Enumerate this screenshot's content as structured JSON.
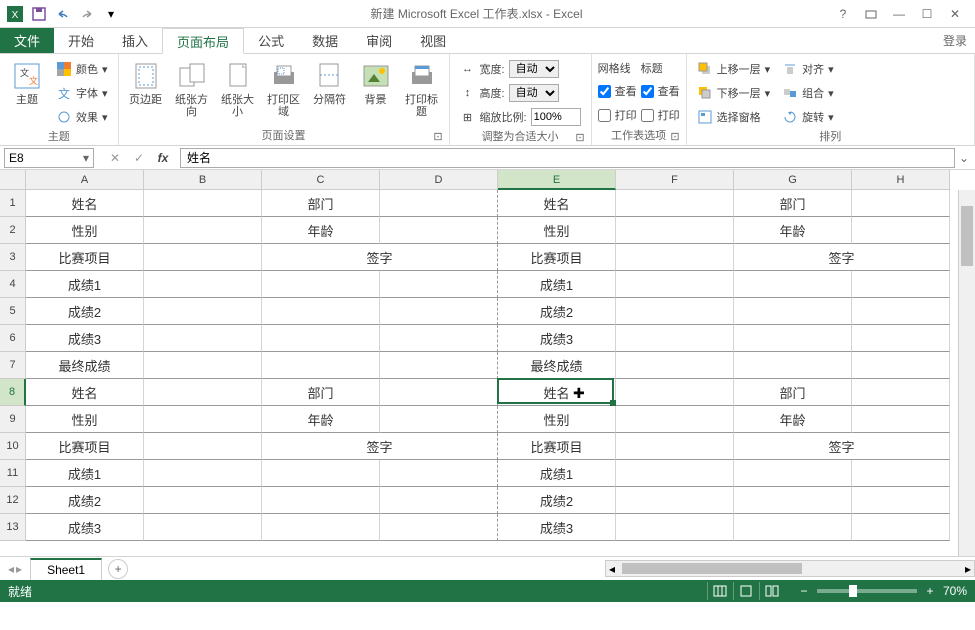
{
  "title": "新建 Microsoft Excel 工作表.xlsx - Excel",
  "menubar": {
    "file": "文件",
    "tabs": [
      "开始",
      "插入",
      "页面布局",
      "公式",
      "数据",
      "审阅",
      "视图"
    ],
    "activeIndex": 2,
    "login": "登录"
  },
  "ribbon": {
    "groups": {
      "theme": {
        "label": "主题",
        "themeBtn": "主题",
        "colors": "颜色",
        "fonts": "字体",
        "effects": "效果"
      },
      "pageSetup": {
        "label": "页面设置",
        "margins": "页边距",
        "orientation": "纸张方向",
        "size": "纸张大小",
        "printArea": "打印区域",
        "breaks": "分隔符",
        "background": "背景",
        "printTitles": "打印标题"
      },
      "scaleToFit": {
        "label": "调整为合适大小",
        "widthLabel": "宽度:",
        "widthValue": "自动",
        "heightLabel": "高度:",
        "heightValue": "自动",
        "scaleLabel": "缩放比例:",
        "scaleValue": "100%"
      },
      "sheetOptions": {
        "label": "工作表选项",
        "gridlines": "网格线",
        "headings": "标题",
        "view": "查看",
        "print": "打印"
      },
      "arrange": {
        "label": "排列",
        "bringForward": "上移一层",
        "sendBackward": "下移一层",
        "selectionPane": "选择窗格",
        "align": "对齐",
        "group": "组合",
        "rotate": "旋转"
      }
    }
  },
  "namebox": "E8",
  "formula": "姓名",
  "columns": [
    {
      "name": "A",
      "width": 118
    },
    {
      "name": "B",
      "width": 118
    },
    {
      "name": "C",
      "width": 118
    },
    {
      "name": "D",
      "width": 118
    },
    {
      "name": "E",
      "width": 118
    },
    {
      "name": "F",
      "width": 118
    },
    {
      "name": "G",
      "width": 118
    },
    {
      "name": "H",
      "width": 98
    }
  ],
  "activeCol": 4,
  "activeRow": 7,
  "rows": [
    {
      "r": 1,
      "h": 27,
      "cells": {
        "A": "姓名",
        "C": "部门",
        "E": "姓名",
        "G": "部门"
      }
    },
    {
      "r": 2,
      "h": 27,
      "cells": {
        "A": "性别",
        "C": "年龄",
        "E": "性别",
        "G": "年龄"
      }
    },
    {
      "r": 3,
      "h": 27,
      "cells": {
        "A": "比赛项目",
        "E": "比赛项目"
      },
      "merge": [
        {
          "text": "签字",
          "start": 2,
          "end": 3
        },
        {
          "text": "签字",
          "start": 6,
          "end": 7
        }
      ]
    },
    {
      "r": 4,
      "h": 27,
      "cells": {
        "A": "成绩1",
        "E": "成绩1"
      }
    },
    {
      "r": 5,
      "h": 27,
      "cells": {
        "A": "成绩2",
        "E": "成绩2"
      }
    },
    {
      "r": 6,
      "h": 27,
      "cells": {
        "A": "成绩3",
        "E": "成绩3"
      }
    },
    {
      "r": 7,
      "h": 27,
      "cells": {
        "A": "最终成绩",
        "E": "最终成绩"
      }
    },
    {
      "r": 8,
      "h": 27,
      "cells": {
        "A": "姓名",
        "C": "部门",
        "E": "姓名",
        "G": "部门"
      }
    },
    {
      "r": 9,
      "h": 27,
      "cells": {
        "A": "性别",
        "C": "年龄",
        "E": "性别",
        "G": "年龄"
      }
    },
    {
      "r": 10,
      "h": 27,
      "cells": {
        "A": "比赛项目",
        "E": "比赛项目"
      },
      "merge": [
        {
          "text": "签字",
          "start": 2,
          "end": 3
        },
        {
          "text": "签字",
          "start": 6,
          "end": 7
        }
      ]
    },
    {
      "r": 11,
      "h": 27,
      "cells": {
        "A": "成绩1",
        "E": "成绩1"
      }
    },
    {
      "r": 12,
      "h": 27,
      "cells": {
        "A": "成绩2",
        "E": "成绩2"
      }
    },
    {
      "r": 13,
      "h": 27,
      "cells": {
        "A": "成绩3",
        "E": "成绩3"
      }
    }
  ],
  "sheetTab": "Sheet1",
  "statusbar": {
    "ready": "就绪",
    "zoom": "70%"
  }
}
